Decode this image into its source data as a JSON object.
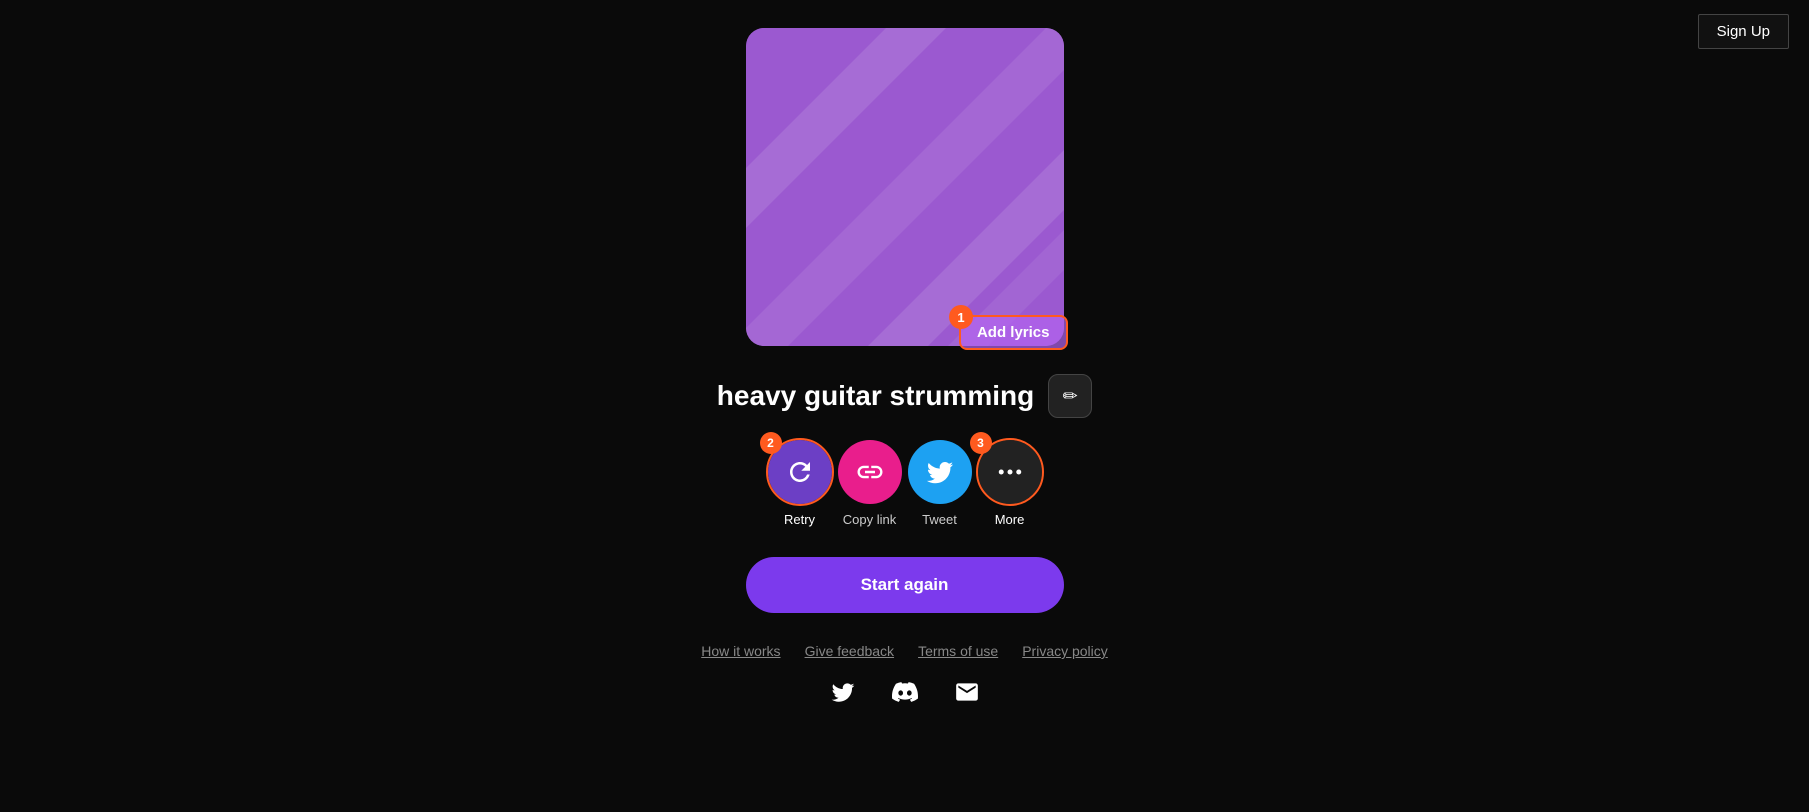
{
  "header": {
    "sign_up_label": "Sign Up"
  },
  "album": {
    "alt": "heavy guitar strumming album art",
    "add_lyrics_label": "Add lyrics",
    "step_1": "1"
  },
  "title": {
    "song_name": "heavy guitar strumming",
    "edit_icon": "✏"
  },
  "actions": [
    {
      "id": "retry",
      "label": "Retry",
      "icon_type": "retry",
      "highlighted": true,
      "step": "2"
    },
    {
      "id": "copy-link",
      "label": "Copy link",
      "icon_type": "link",
      "highlighted": false,
      "step": null
    },
    {
      "id": "tweet",
      "label": "Tweet",
      "icon_type": "twitter",
      "highlighted": false,
      "step": null
    },
    {
      "id": "more",
      "label": "More",
      "icon_type": "dots",
      "highlighted": true,
      "step": "3"
    }
  ],
  "start_again": {
    "label": "Start again"
  },
  "footer": {
    "links": [
      {
        "label": "How it works"
      },
      {
        "label": "Give feedback"
      },
      {
        "label": "Terms of use"
      },
      {
        "label": "Privacy policy"
      }
    ]
  },
  "social": [
    {
      "id": "twitter",
      "icon": "🐦"
    },
    {
      "id": "discord",
      "icon": "🎮"
    },
    {
      "id": "email",
      "icon": "✉"
    }
  ],
  "colors": {
    "accent": "#7c3aed",
    "highlight": "#ff5a1f",
    "bg": "#0a0a0a"
  }
}
